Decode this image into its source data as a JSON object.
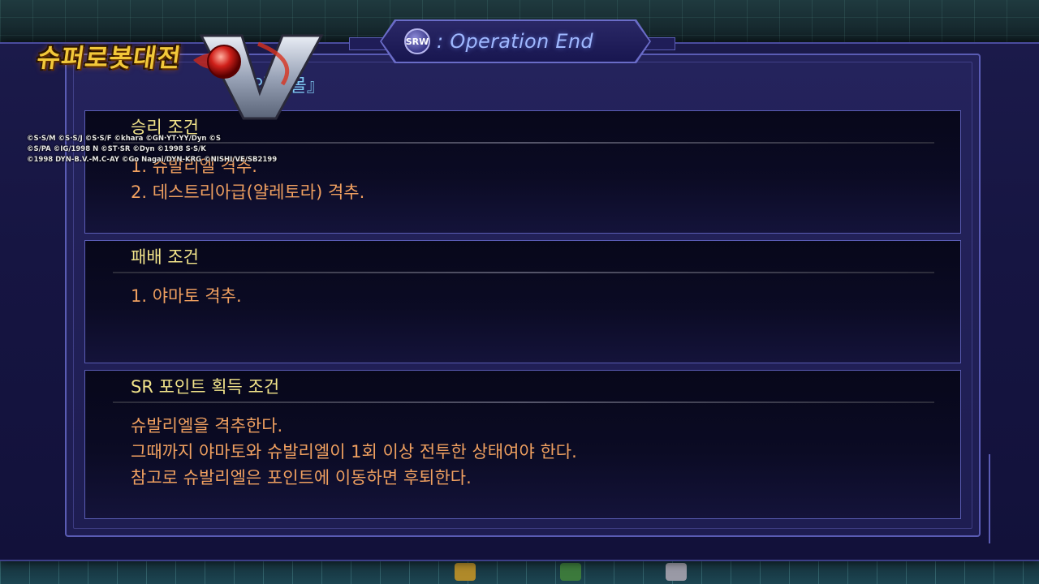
{
  "header": {
    "badge": "SRW",
    "title": ": Operation End"
  },
  "stage_title": "의 일몰』",
  "logo": {
    "title_line1": "슈퍼로봇대전",
    "title_line2": "V",
    "copyright_lines": [
      "©S·S/M  ©S·S/J  ©S·S/F  ©khara  ©GN·YT·YY/Dyn  ©S",
      "©S/PA  ©IG/1998 N  ©ST·SR  ©Dyn  ©1998 S·S/K",
      "©1998 DYN-B.V.-M.C-AY  ©Go Nagai/DYN-KRG  ©NISHI/VE/SB2199"
    ]
  },
  "victory": {
    "heading": "승리 조건",
    "lines": [
      "1. 슈발리엘 격추.",
      "2. 데스트리아급(얄레토라) 격추."
    ]
  },
  "defeat": {
    "heading": "패배 조건",
    "lines": [
      "1. 야마토 격추."
    ]
  },
  "sr_point": {
    "heading": "SR 포인트 획득 조건",
    "lines": [
      "슈발리엘을 격추한다.",
      "그때까지 야마토와 슈발리엘이 1회 이상 전투한 상태여야 한다.",
      "참고로 슈발리엘은 포인트에 이동하면 후퇴한다."
    ]
  },
  "colors": {
    "heading": "#f2e48a",
    "body_text": "#f0a060",
    "title_text": "#9fb8ff",
    "frame": "#5a5cb4"
  }
}
